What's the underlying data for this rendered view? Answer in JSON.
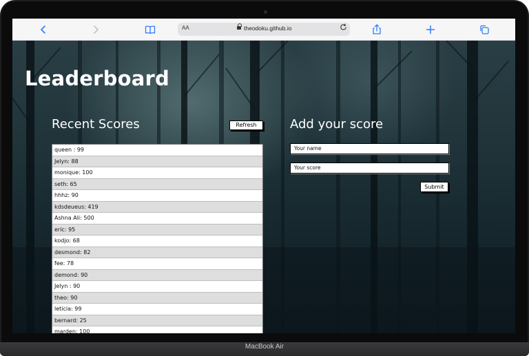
{
  "device": {
    "label": "MacBook Air"
  },
  "browser": {
    "address": "theodoku.github.io",
    "text_size_label": "AA",
    "icons": [
      "back-icon",
      "forward-icon",
      "bookmarks-icon",
      "lock-icon",
      "reload-icon",
      "share-icon",
      "new-tab-icon",
      "tabs-icon"
    ]
  },
  "page": {
    "title": "Leaderboard",
    "recent": {
      "title": "Recent Scores",
      "refresh_label": "Refresh",
      "rows": [
        "queen : 99",
        "Jelyn: 88",
        "monique: 100",
        "seth: 65",
        "hhhz: 90",
        "kdsdeueus: 419",
        "Ashna Ali: 500",
        "eric: 95",
        "kodjo: 68",
        "desmond: 82",
        "fee: 78",
        "demond: 90",
        "Jelyn : 90",
        "theo: 90",
        "leticia: 99",
        "bernard: 25",
        "marden: 100"
      ]
    },
    "add": {
      "title": "Add your score",
      "name_placeholder": "Your name",
      "score_placeholder": "Your score",
      "submit_label": "Submit"
    }
  },
  "colors": {
    "accent": "#2f7cf6",
    "page_text": "#ffffff",
    "row_alt": "#dedede"
  }
}
